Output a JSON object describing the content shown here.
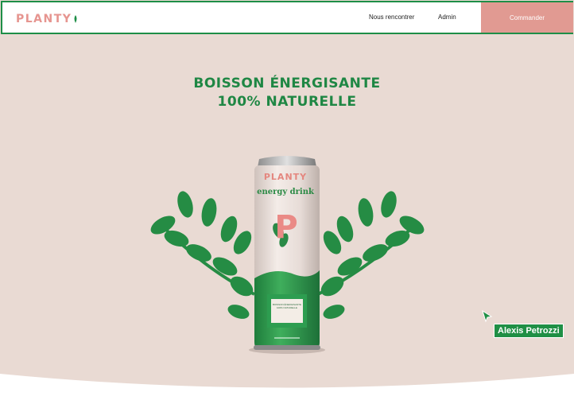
{
  "brand": {
    "logo_text": "PLANTY"
  },
  "nav": {
    "meet_label": "Nous rencontrer",
    "admin_label": "Admin",
    "order_label": "Commander"
  },
  "hero": {
    "headline_line1": "BOISSON ÉNERGISANTE",
    "headline_line2": "100% NATURELLE"
  },
  "can": {
    "brand": "PLANTY",
    "subtitle": "energy drink",
    "letter": "P",
    "label_line1": "BOISSON ÉNERGISANTE",
    "label_line2": "100% NATURELLE"
  },
  "collaborator": {
    "name": "Alexis Petrozzi"
  },
  "colors": {
    "accent_green": "#1e8e47",
    "accent_pink": "#e19a92",
    "background": "#e9dad3"
  },
  "icons": [
    "leaf-icon",
    "mouse-pointer-icon"
  ]
}
